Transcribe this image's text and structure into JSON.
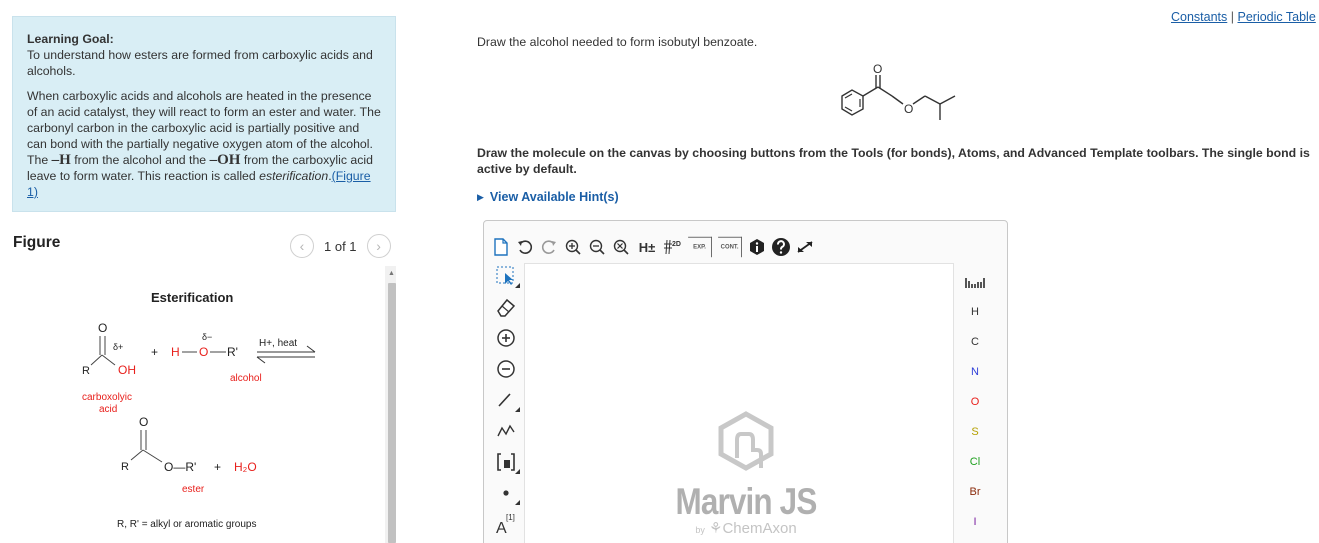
{
  "learning_goal": {
    "title": "Learning Goal:",
    "intro": "To understand how esters are formed from carboxylic acids and alcohols.",
    "para_1": "When carboxylic acids and alcohols are heated in the presence of an acid catalyst, they will react to form an ester and water. The carbonyl carbon in the carboxylic acid is partially positive and can bond with the partially negative oxygen atom of the alcohol. The ",
    "h_symbol": "–H",
    "para_2": " from the alcohol and the ",
    "oh_symbol": "–OH",
    "para_3": " from the carboxylic acid leave to form water. This reaction is called ",
    "term": "esterification",
    "period": ".",
    "figure_link": "(Figure 1)"
  },
  "figure": {
    "label": "Figure",
    "counter": "1 of 1",
    "prev_icon": "chevron-left-icon",
    "next_icon": "chevron-right-icon",
    "title": "Esterification",
    "plus_1": "+",
    "delta_plus": "δ+",
    "delta_minus": "δ−",
    "acid_o": "O",
    "acid_r": "R",
    "acid_oh": "OH",
    "alcohol_h": "H",
    "alcohol_o": "O",
    "alcohol_r": "R'",
    "catalyst": "H+, heat",
    "acid_label_1": "carboxolyic",
    "acid_label_2": "acid",
    "alcohol_label": "alcohol",
    "ester_o_top": "O",
    "ester_r": "R",
    "ester_o_r": "O—R'",
    "plus_2": "+",
    "water": "H₂O",
    "ester_label": "ester",
    "footnote": "R, R' = alkyl or aromatic groups"
  },
  "links": {
    "constants": "Constants",
    "separator": "|",
    "periodic_table": "Periodic Table"
  },
  "question": "Draw the alcohol needed to form isobutyl benzoate.",
  "structure": {
    "o_carbonyl": "O",
    "o_ester": "O"
  },
  "instruction": "Draw the molecule on the canvas by choosing buttons from the Tools (for bonds), Atoms, and Advanced Template toolbars. The single bond is active by default.",
  "hint": "View Available Hint(s)",
  "editor": {
    "top_tools": {
      "h_toggle": "H±",
      "clean_2d": "2D",
      "expand": "EXP.",
      "contract": "CONT."
    },
    "left_tools": {
      "charge_label": "A",
      "charge_superscript": "[1]"
    },
    "watermark_title": "Marvin JS",
    "watermark_by": "by",
    "watermark_company": "ChemAxon",
    "atoms": [
      "H",
      "C",
      "N",
      "O",
      "S",
      "Cl",
      "Br",
      "I"
    ],
    "colors": {
      "H": "#333333",
      "C": "#333333",
      "N": "#2f3fd8",
      "O": "#e8201c",
      "S": "#b5a000",
      "Cl": "#1fa01f",
      "Br": "#8a2a0a",
      "I": "#7a1fa0"
    }
  }
}
